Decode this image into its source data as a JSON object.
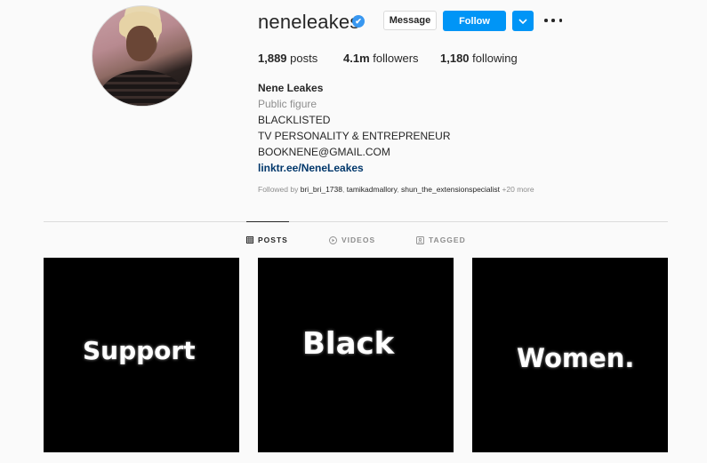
{
  "profile": {
    "username": "neneleakes",
    "verified_badge": "✔",
    "message_label": "Message",
    "follow_label": "Follow",
    "dropdown_icon": "chevron-down-icon",
    "more_icon": "ellipsis-icon",
    "accent_color": "#0095f6"
  },
  "stats": {
    "posts_count": "1,889",
    "posts_label": "posts",
    "followers_count": "4.1m",
    "followers_label": "followers",
    "following_count": "1,180",
    "following_label": "following"
  },
  "bio": {
    "name": "Nene Leakes",
    "category": "Public figure",
    "lines": [
      "BLACKLISTED",
      "TV PERSONALITY & ENTREPRENEUR",
      "BOOKNENE@GMAIL.COM"
    ],
    "link": "linktr.ee/NeneLeakes"
  },
  "followed_by": {
    "prefix": "Followed by",
    "users": [
      "bri_bri_1738",
      "tamikadmallory",
      "shun_the_extensionspecialist"
    ],
    "more": "+20 more"
  },
  "tabs": [
    {
      "label": "POSTS",
      "icon": "grid-icon",
      "active": true
    },
    {
      "label": "VIDEOS",
      "icon": "play-icon",
      "active": false
    },
    {
      "label": "TAGGED",
      "icon": "tag-icon",
      "active": false
    }
  ],
  "posts": [
    {
      "text": "Support"
    },
    {
      "text": "Black"
    },
    {
      "text": "Women."
    }
  ]
}
